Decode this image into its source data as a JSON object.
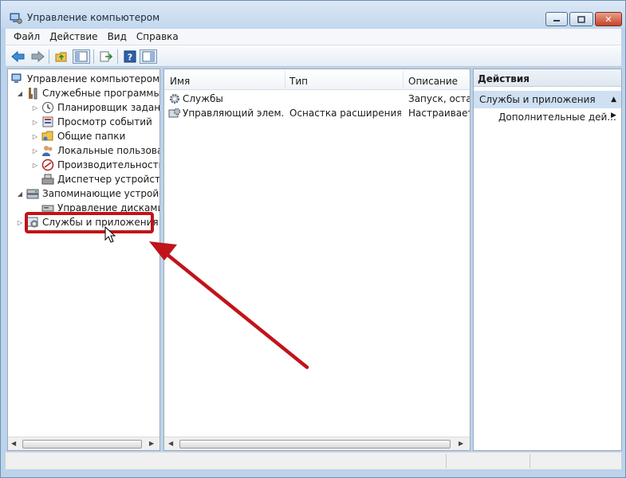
{
  "window": {
    "title": "Управление компьютером",
    "caption_buttons": {
      "minimize": "minimize",
      "maximize": "maximize",
      "close": "✕"
    }
  },
  "menu": [
    "Файл",
    "Действие",
    "Вид",
    "Справка"
  ],
  "toolbar": {
    "buttons": [
      "back-icon",
      "forward-icon",
      "up-folder-icon",
      "show-hide-tree-icon",
      "export-list-icon",
      "help-icon",
      "action-pane-icon"
    ]
  },
  "tree": {
    "root": "Управление компьютером (л",
    "system_tools": "Служебные программы",
    "task_scheduler": "Планировщик заданий",
    "event_viewer": "Просмотр событий",
    "shared_folders": "Общие папки",
    "local_users": "Локальные пользовате",
    "performance": "Производительность",
    "device_manager": "Диспетчер устройств",
    "storage": "Запоминающие устройст",
    "disk_management": "Управление дисками",
    "services_apps": "Службы и приложения"
  },
  "list": {
    "columns": [
      "Имя",
      "Тип",
      "Описание"
    ],
    "rows": [
      {
        "name": "Службы",
        "type": "",
        "description": "Запуск, остан"
      },
      {
        "name": "Управляющий элем...",
        "type": "Оснастка расширения",
        "description": "Настраивает"
      }
    ]
  },
  "actions": {
    "header": "Действия",
    "section": "Службы и приложения",
    "item": "Дополнительные дей..."
  },
  "colors": {
    "highlight": "#c0141a",
    "arrow": "#c0141a",
    "selection_bg": "#cfe0f2"
  }
}
